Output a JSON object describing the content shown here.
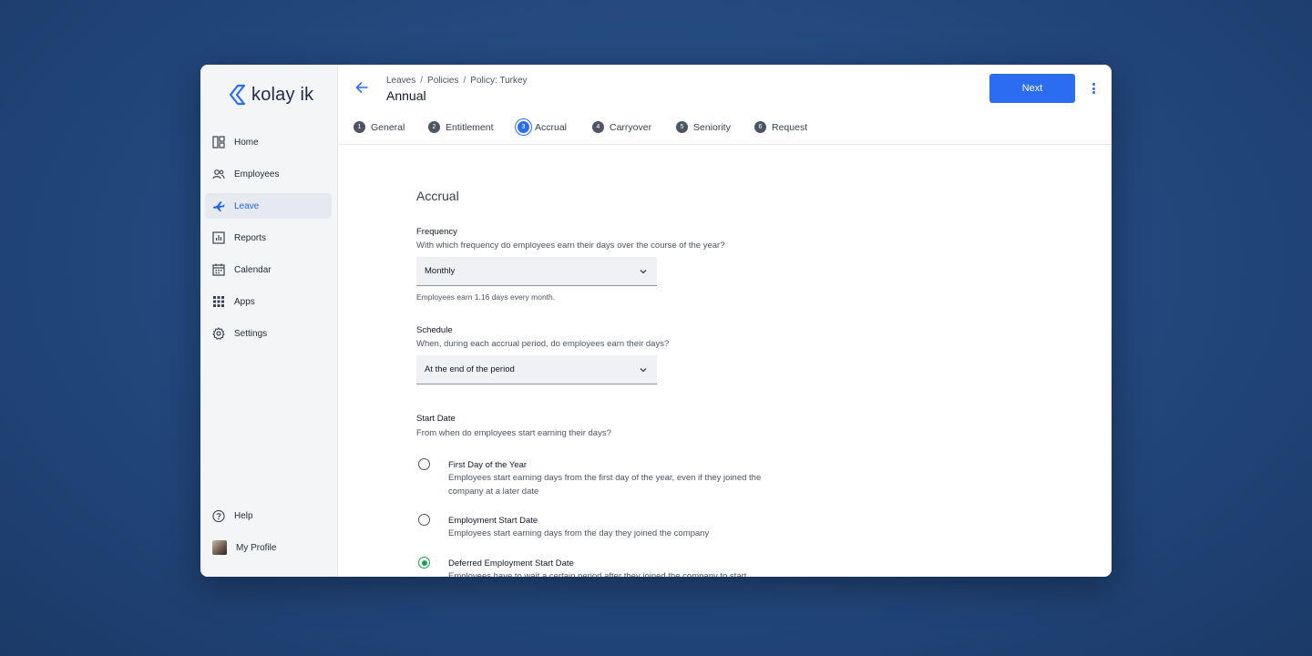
{
  "brand": {
    "name": "kolay ik",
    "accent": "#2b6cf0"
  },
  "sidebar": {
    "items": [
      {
        "label": "Home",
        "icon": "dashboard-icon"
      },
      {
        "label": "Employees",
        "icon": "people-icon"
      },
      {
        "label": "Leave",
        "icon": "airplane-icon",
        "active": true
      },
      {
        "label": "Reports",
        "icon": "bar-chart-icon"
      },
      {
        "label": "Calendar",
        "icon": "calendar-icon"
      },
      {
        "label": "Apps",
        "icon": "grid-icon"
      },
      {
        "label": "Settings",
        "icon": "gear-icon"
      }
    ],
    "bottom": [
      {
        "label": "Help",
        "icon": "help-icon"
      },
      {
        "label": "My Profile",
        "icon": "avatar"
      }
    ]
  },
  "header": {
    "breadcrumb": [
      "Leaves",
      "Policies",
      "Policy: Turkey"
    ],
    "title": "Annual",
    "next_label": "Next"
  },
  "steps": [
    {
      "num": "1",
      "label": "General"
    },
    {
      "num": "2",
      "label": "Entitlement"
    },
    {
      "num": "3",
      "label": "Accrual",
      "active": true
    },
    {
      "num": "4",
      "label": "Carryover"
    },
    {
      "num": "5",
      "label": "Seniority"
    },
    {
      "num": "6",
      "label": "Request"
    }
  ],
  "accrual": {
    "title": "Accrual",
    "frequency": {
      "label": "Frequency",
      "description": "With which frequency do employees earn their days over the course of the year?",
      "value": "Monthly",
      "hint": "Employees earn 1.16 days every month."
    },
    "schedule": {
      "label": "Schedule",
      "description": "When, during each accrual period, do employees earn their days?",
      "value": "At the end of the period"
    },
    "start_date": {
      "label": "Start Date",
      "description": "From when do employees start earning their days?",
      "options": [
        {
          "title": "First Day of the Year",
          "description": "Employees start earning days from the first day of the year, even if they joined the company at a later date",
          "checked": false
        },
        {
          "title": "Employment Start Date",
          "description": "Employees start earning days from the day they joined the company",
          "checked": false
        },
        {
          "title": "Deferred Employment Start Date",
          "description": "Employees have to wait a certain period after they joined the company to start",
          "checked": true
        }
      ]
    }
  }
}
